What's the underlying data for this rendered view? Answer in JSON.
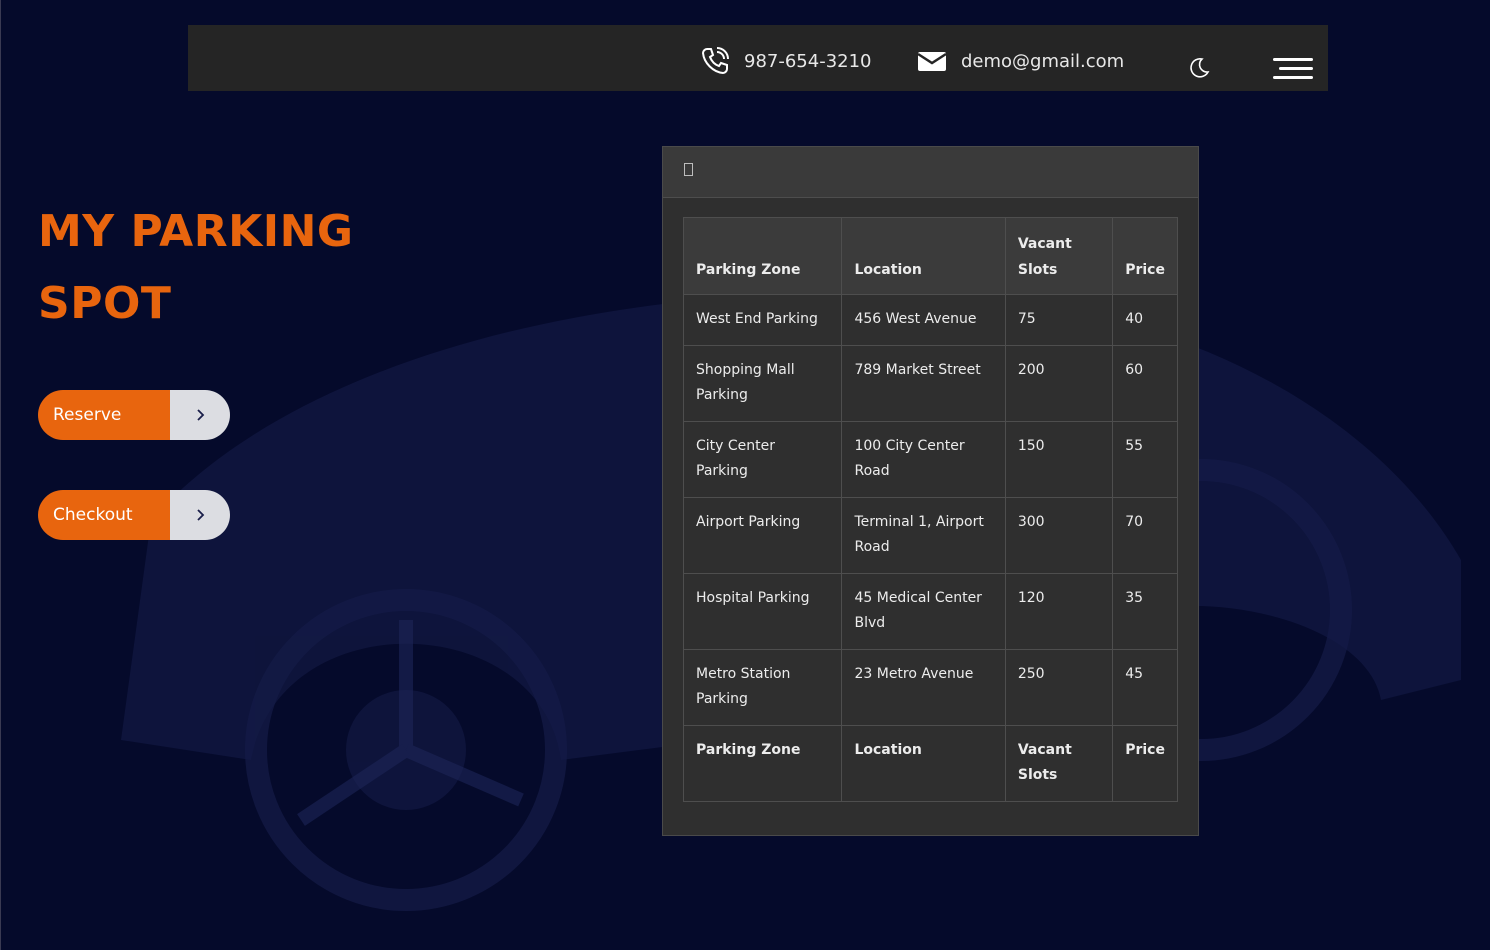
{
  "header": {
    "phone": "987-654-3210",
    "email": "demo@gmail.com",
    "theme_icon": "moon-icon",
    "menu_icon": "hamburger-menu-icon"
  },
  "hero": {
    "title_line1": "MY PARKING",
    "title_line2": "SPOT",
    "buttons": [
      {
        "label": "Reserve",
        "icon": "chevron-right-icon"
      },
      {
        "label": "Checkout",
        "icon": "chevron-right-icon"
      }
    ]
  },
  "table": {
    "headers": [
      "Parking Zone",
      "Location",
      "Vacant Slots",
      "Price"
    ],
    "rows": [
      [
        "West End Parking",
        "456 West Avenue",
        "75",
        "40"
      ],
      [
        "Shopping Mall Parking",
        "789 Market Street",
        "200",
        "60"
      ],
      [
        "City Center Parking",
        "100 City Center Road",
        "150",
        "55"
      ],
      [
        "Airport Parking",
        "Terminal 1, Airport Road",
        "300",
        "70"
      ],
      [
        "Hospital Parking",
        "45 Medical Center Blvd",
        "120",
        "35"
      ],
      [
        "Metro Station Parking",
        "23 Metro Avenue",
        "250",
        "45"
      ]
    ],
    "footers": [
      "Parking Zone",
      "Location",
      "Vacant Slots",
      "Price"
    ]
  },
  "colors": {
    "accent": "#e8650e",
    "background": "#050a2b",
    "topbar": "#252525",
    "panel": "#2f2f2f"
  }
}
